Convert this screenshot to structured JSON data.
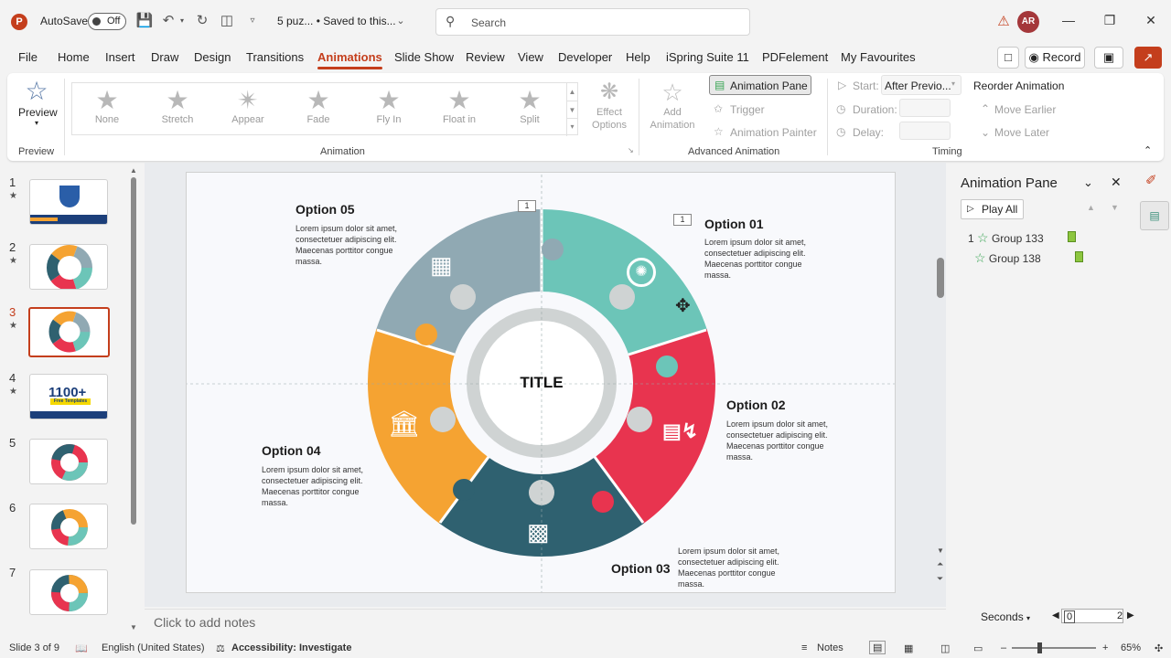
{
  "titlebar": {
    "autosave_label": "AutoSave",
    "autosave_state": "Off",
    "doc_title": "5 puz... • Saved to this...",
    "search_placeholder": "Search",
    "avatar_initials": "AR"
  },
  "menu": {
    "tabs": [
      "File",
      "Home",
      "Insert",
      "Draw",
      "Design",
      "Transitions",
      "Animations",
      "Slide Show",
      "Review",
      "View",
      "Developer",
      "Help",
      "iSpring Suite 11",
      "PDFelement",
      "My Favourites"
    ],
    "active_tab": "Animations",
    "record_label": "Record"
  },
  "ribbon": {
    "preview_label": "Preview",
    "preview_group": "Preview",
    "animations": [
      "None",
      "Stretch",
      "Appear",
      "Fade",
      "Fly In",
      "Float in",
      "Split"
    ],
    "effect_options": "Effect Options",
    "animation_group": "Animation",
    "add_animation": "Add Animation",
    "animation_pane_btn": "Animation Pane",
    "trigger": "Trigger",
    "animation_painter": "Animation Painter",
    "advanced_group": "Advanced Animation",
    "start_label": "Start:",
    "start_value": "After Previo...",
    "duration_label": "Duration:",
    "delay_label": "Delay:",
    "timing_group": "Timing",
    "reorder_title": "Reorder Animation",
    "move_earlier": "Move Earlier",
    "move_later": "Move Later"
  },
  "slides": [
    {
      "num": "1",
      "star": true
    },
    {
      "num": "2",
      "star": true
    },
    {
      "num": "3",
      "star": true,
      "selected": true
    },
    {
      "num": "4",
      "star": true,
      "text": "1100+",
      "sub": "Free Templates"
    },
    {
      "num": "5",
      "star": false
    },
    {
      "num": "6",
      "star": false
    },
    {
      "num": "7",
      "star": false
    }
  ],
  "slide": {
    "title": "TITLE",
    "options": [
      {
        "title": "Option 01",
        "text": "Lorem ipsum dolor sit amet, consectetuer adipiscing elit. Maecenas porttitor congue massa.",
        "tag": "1",
        "color": "#6cc5b8"
      },
      {
        "title": "Option 02",
        "text": "Lorem ipsum dolor sit amet, consectetuer adipiscing elit. Maecenas porttitor congue massa.",
        "color": "#e8344f"
      },
      {
        "title": "Option 03",
        "text": "Lorem ipsum dolor sit amet, consectetuer adipiscing elit. Maecenas porttitor congue massa.",
        "color": "#2f6170"
      },
      {
        "title": "Option 04",
        "text": "Lorem ipsum dolor sit amet, consectetuer adipiscing elit. Maecenas porttitor congue massa.",
        "color": "#f5a332"
      },
      {
        "title": "Option 05",
        "text": "Lorem ipsum dolor sit amet, consectetuer adipiscing elit. Maecenas porttitor congue massa.",
        "tag": "1",
        "color": "#90a9b3"
      }
    ]
  },
  "notes_placeholder": "Click to add notes",
  "animation_pane": {
    "title": "Animation Pane",
    "play_all": "Play All",
    "items": [
      {
        "index": "1",
        "name": "Group 133"
      },
      {
        "index": "",
        "name": "Group 138"
      }
    ],
    "seconds_label": "Seconds",
    "scale_start": "0",
    "scale_end": "2"
  },
  "statusbar": {
    "slide_info": "Slide 3 of 9",
    "language": "English (United States)",
    "accessibility": "Accessibility: Investigate",
    "notes": "Notes",
    "zoom": "65%"
  }
}
